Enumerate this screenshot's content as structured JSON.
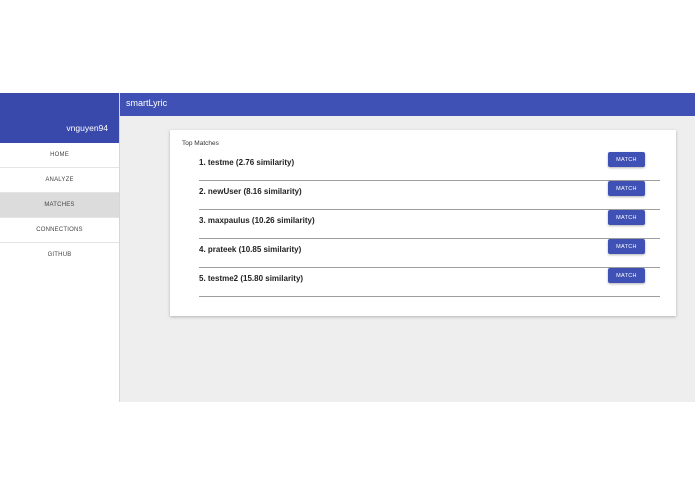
{
  "app": {
    "title": "smartLyric"
  },
  "sidebar": {
    "username": "vnguyen94",
    "items": [
      {
        "label": "HOME"
      },
      {
        "label": "ANALYZE"
      },
      {
        "label": "MATCHES",
        "active": true
      },
      {
        "label": "CONNECTIONS"
      },
      {
        "label": "GITHUB"
      }
    ]
  },
  "main": {
    "card_title": "Top Matches",
    "matches": [
      {
        "text": "1. testme (2.76 similarity)",
        "button": "MATCH"
      },
      {
        "text": "2. newUser (8.16 similarity)",
        "button": "MATCH"
      },
      {
        "text": "3. maxpaulus (10.26 similarity)",
        "button": "MATCH"
      },
      {
        "text": "4. prateek (10.85 similarity)",
        "button": "MATCH"
      },
      {
        "text": "5. testme2 (15.80 similarity)",
        "button": "MATCH"
      }
    ]
  },
  "colors": {
    "sidebar_header": "#3949ab",
    "topbar": "#3f51b5",
    "button": "#3f51b5",
    "content_bg": "#eeeeee"
  }
}
